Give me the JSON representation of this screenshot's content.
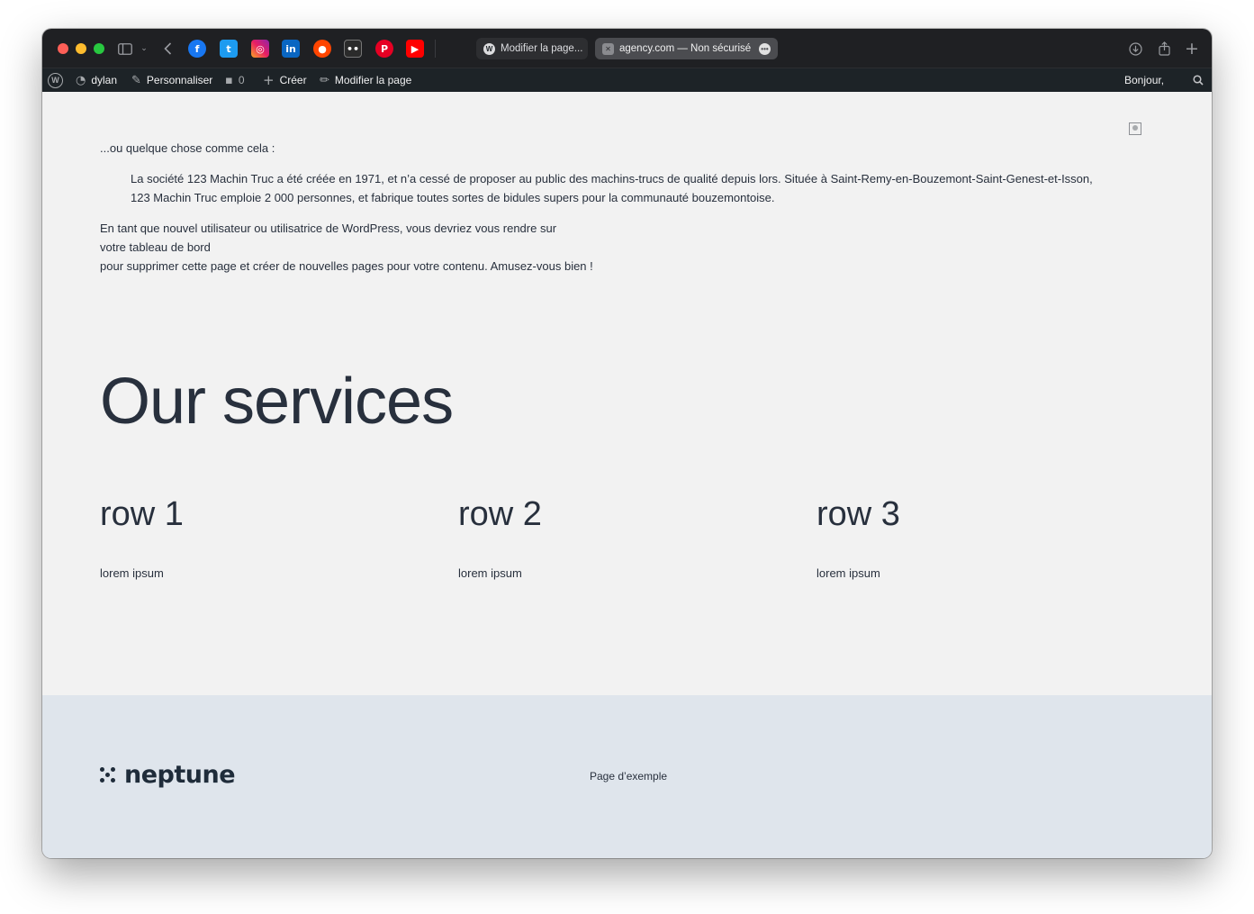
{
  "browser": {
    "tabs": [
      {
        "label": "Modifier la page..."
      },
      {
        "label": "agency.com — Non sécurisé"
      }
    ],
    "bookmarks": [
      "facebook-icon",
      "twitter-icon",
      "instagram-icon",
      "linkedin-icon",
      "reddit-icon",
      "flickr-icon",
      "pinterest-icon",
      "youtube-icon"
    ]
  },
  "adminbar": {
    "user": "dylan",
    "customize": "Personnaliser",
    "comments_count": "0",
    "create": "Créer",
    "edit_page": "Modifier la page",
    "greeting": "Bonjour,"
  },
  "content": {
    "intro": "...ou quelque chose comme cela :",
    "quote_line1": "La société 123 Machin Truc a été créée en 1971, et n’a cessé de proposer au public des machins-trucs de qualité depuis lors. Située à Saint-Remy-en-Bouzemont-Saint-Genest-et-Isson,",
    "quote_line2": "123 Machin Truc emploie 2 000 personnes, et fabrique toutes sortes de bidules supers pour la communauté bouzemontoise.",
    "para_line1": "En tant que nouvel utilisateur ou utilisatrice de WordPress, vous devriez vous rendre sur",
    "para_link": "votre tableau de bord",
    "para_line3": "pour supprimer cette page et créer de nouvelles pages pour votre contenu. Amusez-vous bien !"
  },
  "services": {
    "title": "Our services",
    "rows": [
      {
        "title": "row 1",
        "text": "lorem ipsum"
      },
      {
        "title": "row 2",
        "text": "lorem ipsum"
      },
      {
        "title": "row 3",
        "text": "lorem ipsum"
      }
    ]
  },
  "footer": {
    "logo_text": "neptune",
    "link": "Page d’exemple"
  }
}
